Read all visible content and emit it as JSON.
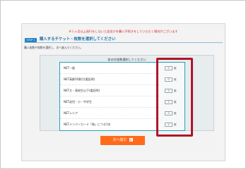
{
  "notice": "※１ヶ月以上発行をしないと返金かを購入手続きをしていただく場合がございます",
  "step": {
    "badge": "STEP 1",
    "title": "購入するチケット・枚数を選択してください"
  },
  "instruction": "購入枚数や枚数を選択し、次へ進んでください。",
  "panel": {
    "heading": "各お任枚数選択してください"
  },
  "tickets": [
    {
      "name": "NET一般",
      "price": "￥1,800",
      "qty": "0",
      "unit": "枚"
    },
    {
      "name": "NET高齢50割引(要証明)",
      "price": "￥1,100",
      "qty": "0",
      "unit": "枚"
    },
    {
      "name": "NET大・高校生以下(要証明)",
      "price": "￥1,500",
      "qty": "0",
      "unit": "枚"
    },
    {
      "name": "NET幼児・小・中学生",
      "price": "￥1,100",
      "qty": "0",
      "unit": "枚"
    },
    {
      "name": "NETシニア",
      "price": "￥1,100",
      "qty": "0",
      "unit": "枚"
    },
    {
      "name": "NETメンバーカード「無」につき1名",
      "price": "￥1,600",
      "qty": "0",
      "unit": "枚"
    }
  ],
  "next_button": {
    "label": "次へ進む",
    "arrow": "▸"
  },
  "colors": {
    "accent_blue": "#1f7fc0",
    "teal_border": "#2aa0b5",
    "highlight_red": "#b0142a",
    "button_orange": "#ff6b1a",
    "notice_red": "#d8282a"
  }
}
